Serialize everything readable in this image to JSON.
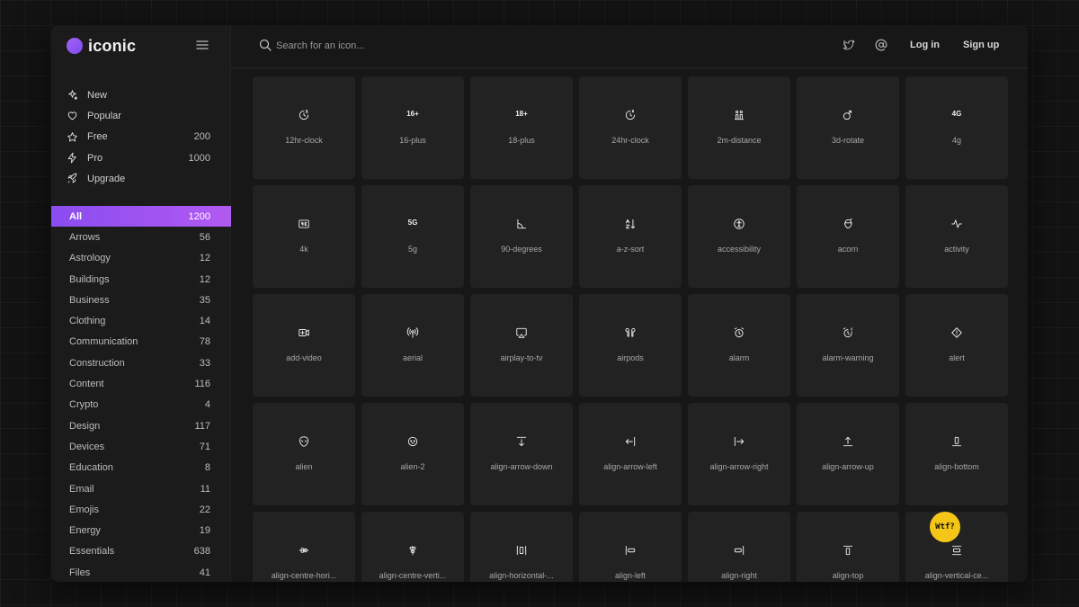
{
  "brand": {
    "name": "iconic",
    "accent": "#9b5cf4"
  },
  "search": {
    "placeholder": "Search for an icon...",
    "value": ""
  },
  "header": {
    "login": "Log in",
    "signup": "Sign up"
  },
  "nav": [
    {
      "label": "New",
      "icon": "sparkle-icon",
      "count": ""
    },
    {
      "label": "Popular",
      "icon": "heart-icon",
      "count": ""
    },
    {
      "label": "Free",
      "icon": "star-icon",
      "count": "200"
    },
    {
      "label": "Pro",
      "icon": "lightning-icon",
      "count": "1000"
    },
    {
      "label": "Upgrade",
      "icon": "rocket-icon",
      "count": ""
    }
  ],
  "categories": [
    {
      "label": "All",
      "count": "1200",
      "active": true
    },
    {
      "label": "Arrows",
      "count": "56"
    },
    {
      "label": "Astrology",
      "count": "12"
    },
    {
      "label": "Buildings",
      "count": "12"
    },
    {
      "label": "Business",
      "count": "35"
    },
    {
      "label": "Clothing",
      "count": "14"
    },
    {
      "label": "Communication",
      "count": "78"
    },
    {
      "label": "Construction",
      "count": "33"
    },
    {
      "label": "Content",
      "count": "116"
    },
    {
      "label": "Crypto",
      "count": "4"
    },
    {
      "label": "Design",
      "count": "117"
    },
    {
      "label": "Devices",
      "count": "71"
    },
    {
      "label": "Education",
      "count": "8"
    },
    {
      "label": "Email",
      "count": "11"
    },
    {
      "label": "Emojis",
      "count": "22"
    },
    {
      "label": "Energy",
      "count": "19"
    },
    {
      "label": "Essentials",
      "count": "638"
    },
    {
      "label": "Files",
      "count": "41"
    }
  ],
  "icons": [
    {
      "label": "12hr-clock",
      "icon": "clock-12hr-icon"
    },
    {
      "label": "16-plus",
      "icon": "16-plus-icon",
      "text": "16+"
    },
    {
      "label": "18-plus",
      "icon": "18-plus-icon",
      "text": "18+"
    },
    {
      "label": "24hr-clock",
      "icon": "clock-24hr-icon"
    },
    {
      "label": "2m-distance",
      "icon": "distance-icon"
    },
    {
      "label": "3d-rotate",
      "icon": "rotate-3d-icon"
    },
    {
      "label": "4g",
      "icon": "4g-icon",
      "text": "4G"
    },
    {
      "label": "4k",
      "icon": "4k-icon"
    },
    {
      "label": "5g",
      "icon": "5g-icon",
      "text": "5G"
    },
    {
      "label": "90-degrees",
      "icon": "angle-icon"
    },
    {
      "label": "a-z-sort",
      "icon": "sort-icon"
    },
    {
      "label": "accessibility",
      "icon": "accessibility-icon"
    },
    {
      "label": "acorn",
      "icon": "acorn-icon"
    },
    {
      "label": "activity",
      "icon": "activity-icon"
    },
    {
      "label": "add-video",
      "icon": "add-video-icon"
    },
    {
      "label": "aerial",
      "icon": "aerial-icon"
    },
    {
      "label": "airplay-to-tv",
      "icon": "airplay-icon"
    },
    {
      "label": "airpods",
      "icon": "airpods-icon"
    },
    {
      "label": "alarm",
      "icon": "alarm-icon"
    },
    {
      "label": "alarm-warning",
      "icon": "alarm-warning-icon"
    },
    {
      "label": "alert",
      "icon": "alert-icon"
    },
    {
      "label": "alien",
      "icon": "alien-icon"
    },
    {
      "label": "alien-2",
      "icon": "alien-2-icon"
    },
    {
      "label": "align-arrow-down",
      "icon": "align-arrow-down-icon"
    },
    {
      "label": "align-arrow-left",
      "icon": "align-arrow-left-icon"
    },
    {
      "label": "align-arrow-right",
      "icon": "align-arrow-right-icon"
    },
    {
      "label": "align-arrow-up",
      "icon": "align-arrow-up-icon"
    },
    {
      "label": "align-bottom",
      "icon": "align-bottom-icon"
    },
    {
      "label": "align-centre-hori...",
      "icon": "align-centre-horizontal-icon"
    },
    {
      "label": "align-centre-verti...",
      "icon": "align-centre-vertical-icon"
    },
    {
      "label": "align-horizontal-...",
      "icon": "align-horizontal-icon"
    },
    {
      "label": "align-left",
      "icon": "align-left-icon"
    },
    {
      "label": "align-right",
      "icon": "align-right-icon"
    },
    {
      "label": "align-top",
      "icon": "align-top-icon"
    },
    {
      "label": "align-vertical-ce...",
      "icon": "align-vertical-centre-icon"
    }
  ],
  "help_button": "Wtf?"
}
